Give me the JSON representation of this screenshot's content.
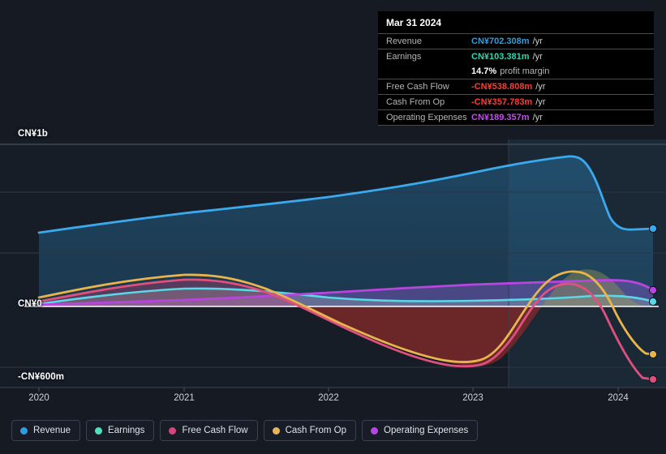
{
  "tooltip": {
    "title": "Mar 31 2024",
    "rows": [
      {
        "label": "Revenue",
        "value": "CN¥702.308m",
        "unit": "/yr",
        "color": "#2f9ee0"
      },
      {
        "label": "Earnings",
        "value": "CN¥103.381m",
        "unit": "/yr",
        "color": "#2fd6b0"
      },
      {
        "label": "",
        "value": "14.7%",
        "unit": "profit margin",
        "color": "#ffffff"
      },
      {
        "label": "Free Cash Flow",
        "value": "-CN¥538.808m",
        "unit": "/yr",
        "color": "#ff3b30"
      },
      {
        "label": "Cash From Op",
        "value": "-CN¥357.783m",
        "unit": "/yr",
        "color": "#ff3b30"
      },
      {
        "label": "Operating Expenses",
        "value": "CN¥189.357m",
        "unit": "/yr",
        "color": "#c44cf0"
      }
    ]
  },
  "legend": [
    {
      "label": "Revenue",
      "color": "#2f9ee0"
    },
    {
      "label": "Earnings",
      "color": "#4fe0c0"
    },
    {
      "label": "Free Cash Flow",
      "color": "#d6457e"
    },
    {
      "label": "Cash From Op",
      "color": "#e8b45c"
    },
    {
      "label": "Operating Expenses",
      "color": "#b845e0"
    }
  ],
  "axis": {
    "y_labels": [
      "CN¥1b",
      "CN¥0",
      "-CN¥600m"
    ],
    "x_labels": [
      "2020",
      "2021",
      "2022",
      "2023",
      "2024"
    ]
  },
  "chart_data": {
    "type": "area",
    "title": "",
    "xlabel": "",
    "ylabel": "CN¥",
    "ylim": [
      -600,
      1000
    ],
    "y_ticks": [
      1000,
      0,
      -600
    ],
    "y_tick_labels": [
      "CN¥1b",
      "CN¥0",
      "-CN¥600m"
    ],
    "x": [
      "2020",
      "2021",
      "2022",
      "2023",
      "2024"
    ],
    "xlim": [
      "2019.88",
      "2024.37"
    ],
    "grid": true,
    "legend_position": "bottom",
    "forecast_start": "2023.25",
    "series": [
      {
        "name": "Revenue",
        "color": "#2f9ee0",
        "values_by_x": [
          {
            "x": "2019.88",
            "y": 455
          },
          {
            "x": "2021.0",
            "y": 530
          },
          {
            "x": "2022.0",
            "y": 570
          },
          {
            "x": "2023.0",
            "y": 700
          },
          {
            "x": "2023.25",
            "y": 745
          },
          {
            "x": "2023.72",
            "y": 880
          },
          {
            "x": "2024.0",
            "y": 720
          },
          {
            "x": "2024.37",
            "y": 702.308
          }
        ],
        "end_value": 702.308
      },
      {
        "name": "Earnings",
        "color": "#4fe0c0",
        "values_by_x": [
          {
            "x": "2019.88",
            "y": 18
          },
          {
            "x": "2021.0",
            "y": 120
          },
          {
            "x": "2022.0",
            "y": 55
          },
          {
            "x": "2023.0",
            "y": 62
          },
          {
            "x": "2023.72",
            "y": 85
          },
          {
            "x": "2024.37",
            "y": 103.381
          }
        ],
        "end_value": 103.381
      },
      {
        "name": "Free Cash Flow",
        "color": "#d6457e",
        "values_by_x": [
          {
            "x": "2019.88",
            "y": 35
          },
          {
            "x": "2021.0",
            "y": 135
          },
          {
            "x": "2022.0",
            "y": -90
          },
          {
            "x": "2022.85",
            "y": -405
          },
          {
            "x": "2023.25",
            "y": -300
          },
          {
            "x": "2023.75",
            "y": 125
          },
          {
            "x": "2024.1",
            "y": 30
          },
          {
            "x": "2024.37",
            "y": -538.808
          }
        ],
        "end_value": -538.808
      },
      {
        "name": "Cash From Op",
        "color": "#e8b45c",
        "values_by_x": [
          {
            "x": "2019.88",
            "y": 52
          },
          {
            "x": "2021.0",
            "y": 160
          },
          {
            "x": "2022.0",
            "y": -70
          },
          {
            "x": "2022.85",
            "y": -380
          },
          {
            "x": "2023.25",
            "y": -250
          },
          {
            "x": "2023.8",
            "y": 205
          },
          {
            "x": "2024.1",
            "y": 120
          },
          {
            "x": "2024.37",
            "y": -357.783
          }
        ],
        "end_value": -357.783
      },
      {
        "name": "Operating Expenses",
        "color": "#b845e0",
        "values_by_x": [
          {
            "x": "2019.88",
            "y": 8
          },
          {
            "x": "2021.0",
            "y": 22
          },
          {
            "x": "2022.0",
            "y": 68
          },
          {
            "x": "2023.0",
            "y": 105
          },
          {
            "x": "2023.72",
            "y": 140
          },
          {
            "x": "2024.37",
            "y": 189.357
          }
        ],
        "end_value": 189.357
      }
    ]
  }
}
